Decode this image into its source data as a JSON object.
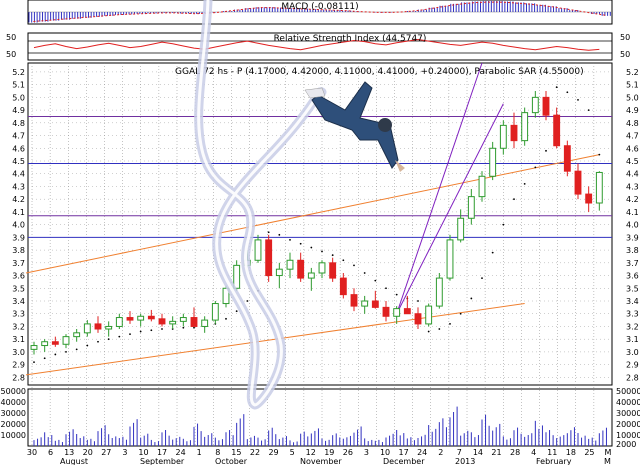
{
  "chart_data": {
    "type": "candlestick",
    "colors": {
      "up": "#2e9a2e",
      "down": "#e02020",
      "volume": "#3030c0",
      "macd_hist": "#3030c0",
      "macd_signal": "#e02020",
      "rsi": "#e02020",
      "sar": "#000000",
      "channel": "#f08030",
      "fan": "#8020c0",
      "support_resistance": "#7030a0",
      "level_line": "#3030c0",
      "grid": "#888888"
    },
    "macd_panel": {
      "label": "MACD (-0.08111)",
      "values": [
        -0.22,
        -0.2,
        -0.18,
        -0.16,
        -0.14,
        -0.12,
        -0.1,
        -0.08,
        -0.06,
        -0.05,
        -0.04,
        -0.03,
        -0.02,
        -0.02,
        -0.03,
        -0.04,
        -0.03,
        -0.01,
        0.02,
        0.05,
        0.08,
        0.1,
        0.1,
        0.09,
        0.08,
        0.07,
        0.06,
        0.05,
        0.04,
        0.03,
        0.01,
        0.0,
        -0.01,
        -0.01,
        0.0,
        0.02,
        0.05,
        0.09,
        0.13,
        0.17,
        0.2,
        0.22,
        0.23,
        0.23,
        0.22,
        0.2,
        0.18,
        0.15,
        0.12,
        0.08,
        0.04,
        0.0,
        -0.04,
        -0.08
      ]
    },
    "rsi_panel": {
      "label": "Relative Strength Index (44.5747)",
      "ticks": [
        "50",
        "50"
      ],
      "values": [
        48,
        52,
        55,
        50,
        46,
        49,
        53,
        56,
        52,
        48,
        50,
        54,
        58,
        55,
        51,
        47,
        45,
        49,
        53,
        57,
        60,
        56,
        52,
        49,
        46,
        44,
        48,
        52,
        55,
        58,
        61,
        59,
        55,
        53,
        57,
        60,
        63,
        60,
        57,
        54,
        52,
        55,
        58,
        56,
        52,
        49,
        46,
        44,
        47,
        50,
        48,
        45,
        43,
        44.6
      ]
    },
    "price_panel": {
      "label": "GGAL-72 hs - P (4.17000, 4.42000, 4.11000, 4.41000, +0.24000), Parabolic SAR (4.55000)",
      "y_ticks": [
        "5.2",
        "5.1",
        "5.0",
        "4.9",
        "4.8",
        "4.7",
        "4.6",
        "4.5",
        "4.4",
        "4.3",
        "4.2",
        "4.1",
        "4.0",
        "3.9",
        "3.8",
        "3.7",
        "3.6",
        "3.5",
        "3.4",
        "3.3",
        "3.2",
        "3.1",
        "3.0",
        "2.9",
        "2.8"
      ],
      "y_range": [
        2.74,
        5.27
      ],
      "horizontal_levels": [
        4.85,
        4.48,
        4.07,
        3.9
      ],
      "candles": [
        [
          3.02,
          3.08,
          2.98,
          3.05
        ],
        [
          3.05,
          3.1,
          3.0,
          3.08
        ],
        [
          3.08,
          3.12,
          3.04,
          3.06
        ],
        [
          3.06,
          3.14,
          3.03,
          3.12
        ],
        [
          3.12,
          3.18,
          3.08,
          3.15
        ],
        [
          3.15,
          3.25,
          3.12,
          3.22
        ],
        [
          3.22,
          3.28,
          3.15,
          3.18
        ],
        [
          3.18,
          3.24,
          3.12,
          3.2
        ],
        [
          3.2,
          3.3,
          3.18,
          3.27
        ],
        [
          3.27,
          3.32,
          3.22,
          3.25
        ],
        [
          3.25,
          3.3,
          3.2,
          3.28
        ],
        [
          3.28,
          3.33,
          3.24,
          3.26
        ],
        [
          3.26,
          3.3,
          3.2,
          3.22
        ],
        [
          3.22,
          3.28,
          3.18,
          3.24
        ],
        [
          3.24,
          3.3,
          3.2,
          3.27
        ],
        [
          3.27,
          3.35,
          3.22,
          3.2
        ],
        [
          3.2,
          3.28,
          3.15,
          3.25
        ],
        [
          3.25,
          3.4,
          3.22,
          3.38
        ],
        [
          3.38,
          3.52,
          3.35,
          3.5
        ],
        [
          3.5,
          3.72,
          3.48,
          3.68
        ],
        [
          3.68,
          3.8,
          3.6,
          3.72
        ],
        [
          3.72,
          3.92,
          3.7,
          3.88
        ],
        [
          3.88,
          3.92,
          3.55,
          3.6
        ],
        [
          3.6,
          3.7,
          3.5,
          3.65
        ],
        [
          3.65,
          3.78,
          3.58,
          3.72
        ],
        [
          3.72,
          3.78,
          3.55,
          3.58
        ],
        [
          3.58,
          3.66,
          3.48,
          3.62
        ],
        [
          3.62,
          3.72,
          3.58,
          3.7
        ],
        [
          3.7,
          3.74,
          3.55,
          3.58
        ],
        [
          3.58,
          3.62,
          3.42,
          3.45
        ],
        [
          3.45,
          3.5,
          3.32,
          3.36
        ],
        [
          3.36,
          3.44,
          3.3,
          3.4
        ],
        [
          3.4,
          3.48,
          3.34,
          3.35
        ],
        [
          3.35,
          3.4,
          3.24,
          3.28
        ],
        [
          3.28,
          3.36,
          3.22,
          3.34
        ],
        [
          3.34,
          3.44,
          3.3,
          3.3
        ],
        [
          3.3,
          3.35,
          3.18,
          3.22
        ],
        [
          3.22,
          3.38,
          3.2,
          3.36
        ],
        [
          3.36,
          3.62,
          3.34,
          3.58
        ],
        [
          3.58,
          3.92,
          3.56,
          3.88
        ],
        [
          3.88,
          4.12,
          3.86,
          4.05
        ],
        [
          4.05,
          4.28,
          4.0,
          4.22
        ],
        [
          4.22,
          4.42,
          4.18,
          4.38
        ],
        [
          4.38,
          4.65,
          4.35,
          4.6
        ],
        [
          4.6,
          4.82,
          4.55,
          4.78
        ],
        [
          4.78,
          4.88,
          4.6,
          4.66
        ],
        [
          4.66,
          4.92,
          4.62,
          4.88
        ],
        [
          4.88,
          5.05,
          4.84,
          5.0
        ],
        [
          5.0,
          5.05,
          4.82,
          4.86
        ],
        [
          4.86,
          4.92,
          4.6,
          4.62
        ],
        [
          4.62,
          4.66,
          4.38,
          4.42
        ],
        [
          4.42,
          4.48,
          4.2,
          4.24
        ],
        [
          4.24,
          4.3,
          4.1,
          4.17
        ],
        [
          4.17,
          4.42,
          4.11,
          4.41
        ]
      ],
      "sar": [
        2.92,
        2.95,
        2.98,
        3.0,
        3.02,
        3.05,
        3.08,
        3.1,
        3.12,
        3.14,
        3.16,
        3.17,
        3.18,
        3.18,
        3.19,
        3.19,
        3.2,
        3.22,
        3.26,
        3.32,
        3.4,
        3.48,
        3.94,
        3.92,
        3.88,
        3.85,
        3.82,
        3.79,
        3.76,
        3.72,
        3.68,
        3.62,
        3.56,
        3.5,
        3.45,
        3.42,
        3.4,
        3.16,
        3.18,
        3.22,
        3.3,
        3.42,
        3.58,
        3.78,
        4.0,
        4.2,
        4.32,
        4.45,
        4.58,
        5.08,
        5.04,
        4.98,
        4.9,
        4.55
      ],
      "orange_lines": [
        {
          "start": [
            0,
            3.62
          ],
          "end": [
            53,
            4.55
          ]
        },
        {
          "start": [
            0,
            2.82
          ],
          "end": [
            46,
            3.38
          ]
        }
      ],
      "fan_lines": [
        {
          "start": [
            34,
            3.3
          ],
          "end": [
            42,
            5.27
          ]
        },
        {
          "start": [
            34,
            3.3
          ],
          "end": [
            44,
            4.95
          ]
        }
      ]
    },
    "volume_panel": {
      "y_ticks": [
        "50000",
        "40000",
        "30000",
        "20000",
        "10000"
      ],
      "right_ticks": [
        "50000",
        "40000",
        "30000",
        "20000",
        "10000",
        "2000"
      ],
      "values": [
        12000,
        18000,
        8000,
        22000,
        15000,
        9000,
        26000,
        14000,
        11000,
        32000,
        17000,
        8000,
        21000,
        12000,
        9000,
        28000,
        16000,
        10000,
        19000,
        38000,
        14000,
        11000,
        24000,
        13000,
        7000,
        18000,
        22000,
        9000,
        15000,
        12000,
        27000,
        10000,
        8000,
        16000,
        20000,
        11000,
        14000,
        25000,
        33000,
        47000,
        21000,
        18000,
        41000,
        29000,
        12000,
        23000,
        16000,
        30000,
        19000,
        13000,
        26000,
        17000,
        11000,
        24000
      ]
    },
    "x_axis": {
      "day_ticks": [
        "30",
        "6",
        "13",
        "20",
        "27",
        "3",
        "10",
        "17",
        "24",
        "1",
        "8",
        "15",
        "22",
        "29",
        "5",
        "12",
        "19",
        "26",
        "3",
        "10",
        "17",
        "24",
        "2",
        "7",
        "14",
        "21",
        "28",
        "4",
        "11",
        "18",
        "25",
        "M"
      ],
      "month_labels": [
        "August",
        "September",
        "October",
        "November",
        "December",
        "2013",
        "February",
        "M"
      ]
    }
  }
}
